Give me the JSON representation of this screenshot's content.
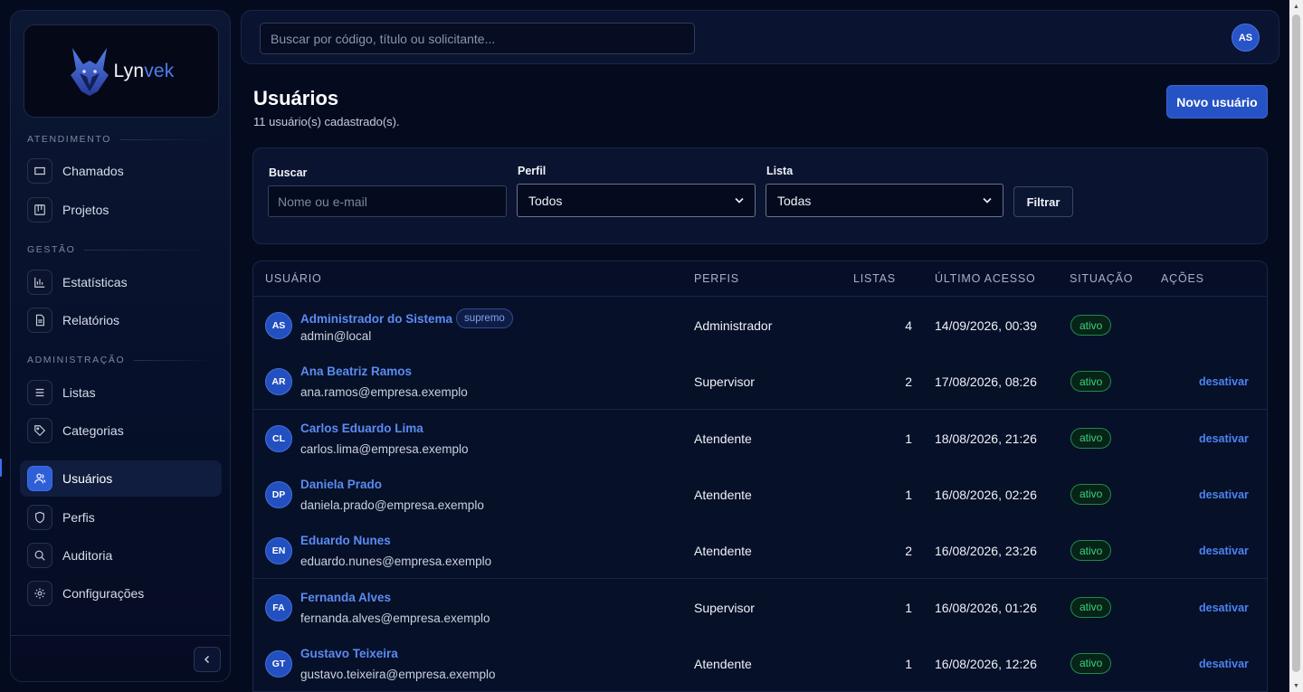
{
  "app": {
    "logo_prefix": "Lyn",
    "logo_accent": "vek"
  },
  "colors": {
    "accent": "#2552c4",
    "link": "#5b8bf2",
    "status_active": "#39d27a",
    "background": "#050b1f"
  },
  "sidebar": {
    "sections": [
      {
        "label": "ATENDIMENTO",
        "items": [
          {
            "label": "Chamados",
            "icon": "ticket-icon"
          },
          {
            "label": "Projetos",
            "icon": "kanban-icon"
          }
        ]
      },
      {
        "label": "GESTÃO",
        "items": [
          {
            "label": "Estatísticas",
            "icon": "bar-chart-icon"
          },
          {
            "label": "Relatórios",
            "icon": "document-icon"
          }
        ]
      },
      {
        "label": "ADMINISTRAÇÃO",
        "items": [
          {
            "label": "Listas",
            "icon": "list-icon"
          },
          {
            "label": "Categorias",
            "icon": "tag-icon"
          },
          {
            "label": "Usuários",
            "icon": "users-icon",
            "active": true
          },
          {
            "label": "Perfis",
            "icon": "shield-icon"
          },
          {
            "label": "Auditoria",
            "icon": "search-icon"
          },
          {
            "label": "Configurações",
            "icon": "gear-icon"
          }
        ]
      }
    ]
  },
  "topbar": {
    "search_placeholder": "Buscar por código, título ou solicitante...",
    "user_initials": "AS"
  },
  "page": {
    "title": "Usuários",
    "subtitle": "11 usuário(s) cadastrado(s).",
    "new_button": "Novo usuário"
  },
  "filters": {
    "search_label": "Buscar",
    "search_placeholder": "Nome ou e-mail",
    "profile_label": "Perfil",
    "profile_value": "Todos",
    "list_label": "Lista",
    "list_value": "Todas",
    "filter_button": "Filtrar"
  },
  "table": {
    "headers": {
      "user": "USUÁRIO",
      "profiles": "PERFIS",
      "lists": "LISTAS",
      "last_access": "ÚLTIMO ACESSO",
      "status": "SITUAÇÃO",
      "actions": "AÇÕES"
    },
    "rows": [
      {
        "initials": "AS",
        "name": "Administrador do Sistema",
        "badge": "supremo",
        "email": "admin@local",
        "profile": "Administrador",
        "lists": "4",
        "last_access": "14/09/2026, 00:39",
        "status": "ativo",
        "action": ""
      },
      {
        "initials": "AR",
        "name": "Ana Beatriz Ramos",
        "badge": "",
        "email": "ana.ramos@empresa.exemplo",
        "profile": "Supervisor",
        "lists": "2",
        "last_access": "17/08/2026, 08:26",
        "status": "ativo",
        "action": "desativar"
      },
      {
        "initials": "CL",
        "name": "Carlos Eduardo Lima",
        "badge": "",
        "email": "carlos.lima@empresa.exemplo",
        "profile": "Atendente",
        "lists": "1",
        "last_access": "18/08/2026, 21:26",
        "status": "ativo",
        "action": "desativar"
      },
      {
        "initials": "DP",
        "name": "Daniela Prado",
        "badge": "",
        "email": "daniela.prado@empresa.exemplo",
        "profile": "Atendente",
        "lists": "1",
        "last_access": "16/08/2026, 02:26",
        "status": "ativo",
        "action": "desativar"
      },
      {
        "initials": "EN",
        "name": "Eduardo Nunes",
        "badge": "",
        "email": "eduardo.nunes@empresa.exemplo",
        "profile": "Atendente",
        "lists": "2",
        "last_access": "16/08/2026, 23:26",
        "status": "ativo",
        "action": "desativar"
      },
      {
        "initials": "FA",
        "name": "Fernanda Alves",
        "badge": "",
        "email": "fernanda.alves@empresa.exemplo",
        "profile": "Supervisor",
        "lists": "1",
        "last_access": "16/08/2026, 01:26",
        "status": "ativo",
        "action": "desativar"
      },
      {
        "initials": "GT",
        "name": "Gustavo Teixeira",
        "badge": "",
        "email": "gustavo.teixeira@empresa.exemplo",
        "profile": "Atendente",
        "lists": "1",
        "last_access": "16/08/2026, 12:26",
        "status": "ativo",
        "action": "desativar"
      }
    ]
  }
}
